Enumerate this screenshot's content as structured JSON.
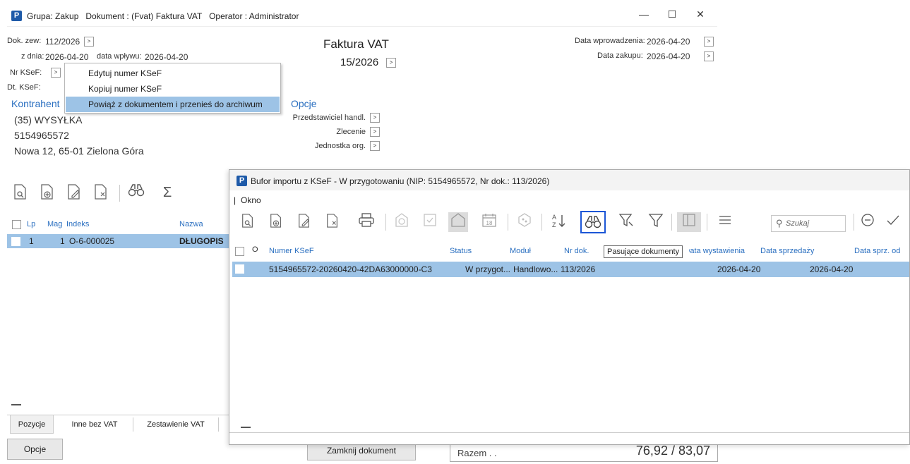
{
  "main_window": {
    "title_logo": "P",
    "title": "Grupa: Zakup   Dokument : (Fvat) Faktura VAT   Operator : Administrator",
    "controls": {
      "minimize": "—",
      "maximize": "☐",
      "close": "✕"
    },
    "header": {
      "dok_zew_label": "Dok. zew:",
      "dok_zew_value": "112/2026",
      "z_dnia_label": "z dnia:",
      "z_dnia_value": "2026-04-20",
      "data_wplywu_label": "data wpływu:",
      "data_wplywu_value": "2026-04-20",
      "nr_ksef_label": "Nr KSeF:",
      "dt_ksef_label": "Dt. KSeF:",
      "doc_type": "Faktura VAT",
      "doc_number": "15/2026",
      "data_wprowadzenia_label": "Data wprowadzenia:",
      "data_wprowadzenia_value": "2026-04-20",
      "data_zakupu_label": "Data zakupu:",
      "data_zakupu_value": "2026-04-20",
      "arrow": ">"
    },
    "context_menu": [
      {
        "label": "Edytuj numer KSeF",
        "selected": false
      },
      {
        "label": "Kopiuj numer KSeF",
        "selected": false
      },
      {
        "label": "Powiąż z dokumentem i przenieś do archiwum",
        "selected": true
      }
    ],
    "contractor": {
      "heading": "Kontrahent",
      "line1": "(35) WYSYŁKA",
      "line2": "5154965572",
      "line3": "Nowa 12, 65-01 Zielona Góra"
    },
    "options": {
      "heading": "Opcje",
      "przedstawiciel": "Przedstawiciel handl.",
      "zlecenie": "Zlecenie",
      "jednostka": "Jednostka org."
    },
    "items_grid": {
      "headers": {
        "lp": "Lp",
        "mag": "Mag",
        "indeks": "Indeks",
        "nazwa": "Nazwa"
      },
      "rows": [
        {
          "lp": "1",
          "mag": "1",
          "indeks": "O-6-000025",
          "nazwa": "DŁUGOPIS"
        }
      ]
    },
    "tabs": [
      "Pozycje",
      "Inne bez VAT",
      "Zestawienie VAT"
    ],
    "buttons": {
      "options": "Opcje",
      "close_doc": "Zamknij dokument"
    },
    "totals": {
      "label": "Razem . .",
      "value": "76,92 / 83,07"
    }
  },
  "import_buffer": {
    "title_logo": "P",
    "title": "Bufor importu z KSeF - W przygotowaniu (NIP: 5154965572, Nr dok.: 113/2026)",
    "menu": [
      "Okno"
    ],
    "search_placeholder": "Szukaj",
    "tooltip": "Pasujące dokumenty",
    "calendar_day": "18",
    "grid_headers": {
      "numer": "Numer KSeF",
      "status": "Status",
      "modul": "Moduł",
      "nr_dok": "Nr dok.",
      "data_wystawienia": "Data wystawienia",
      "data_sprzedazy": "Data sprzedaży",
      "data_sprz_od": "Data sprz. od"
    },
    "rows": [
      {
        "numer": "5154965572-20260420-42DA63000000-C3",
        "status": "W przygot...",
        "modul": "Handlowo...",
        "nr_dok": "113/2026",
        "data_wystawienia": "2026-04-20",
        "data_sprzedazy": "2026-04-20"
      }
    ]
  }
}
